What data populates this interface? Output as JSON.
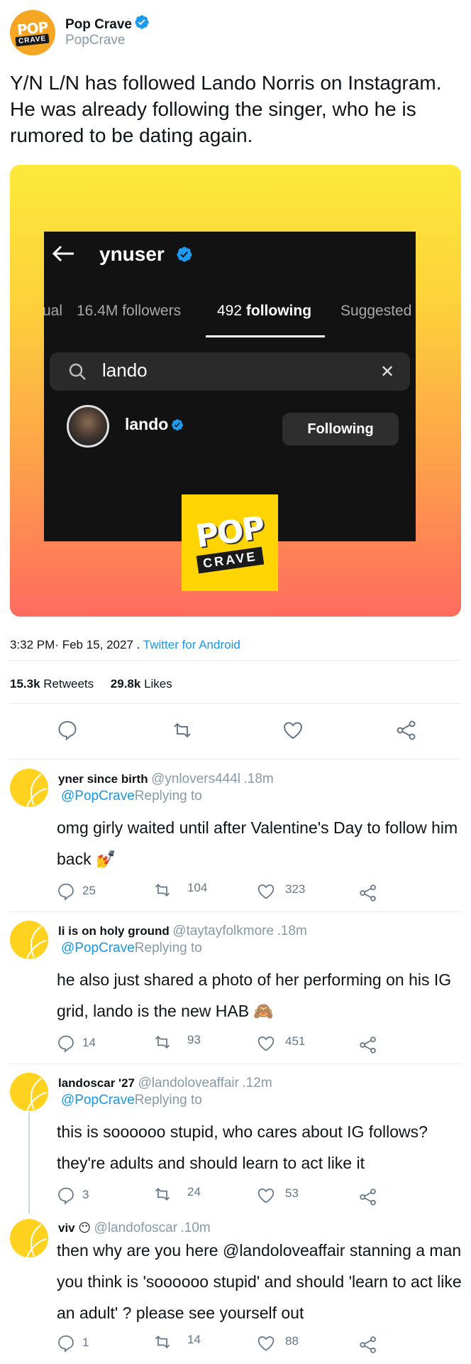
{
  "tweet": {
    "author_name": "Pop Crave",
    "author_handle": "PopCrave",
    "logo_pop": "POP",
    "logo_crave": "CRAVE",
    "text": "Y/N L/N has followed Lando Norris on Instagram. He was already following the singer, who he is rumored to be dating again.",
    "time": "3:32 PM",
    "date": "Feb 15, 2027",
    "separator": "·",
    "dot": " . ",
    "via": "Twitter for Android",
    "retweets_count": "15.3k",
    "retweets_label": "Retweets",
    "likes_count": "29.8k",
    "likes_label": "Likes"
  },
  "media": {
    "profile_user": "ynuser",
    "tab_partial": "ual",
    "followers_count": "16.4M",
    "followers_label": "followers",
    "following_count": "492",
    "following_label": "following",
    "suggested_label": "Suggested",
    "search_value": "lando",
    "clear_glyph": "✕",
    "result_name": "lando",
    "result_button": "Following",
    "watermark_pop": "POP",
    "watermark_crave": "CRAVE"
  },
  "actions": {
    "icons": [
      "reply-icon",
      "retweet-icon",
      "like-icon",
      "share-icon"
    ]
  },
  "replies": [
    {
      "name": "yner since birth",
      "handle": "@ynlovers444l",
      "time": ".18m",
      "replying_at": "@PopCrave",
      "replying_label": "Replying to",
      "text": "omg girly waited until after Valentine's Day to follow him back 💅",
      "reply_count": "25",
      "retweet_count": "104",
      "like_count": "323"
    },
    {
      "name": "li is on holy ground",
      "handle": "@taytayfolkmore",
      "time": ".18m",
      "replying_at": "@PopCrave",
      "replying_label": "Replying to",
      "text": "he also just shared a photo of her performing on his IG grid, lando is the new HAB 🙈",
      "reply_count": "14",
      "retweet_count": "93",
      "like_count": "451"
    },
    {
      "name": "landoscar '27",
      "handle": "@landoloveaffair",
      "time": ".12m",
      "replying_at": "@PopCrave",
      "replying_label": "Replying to",
      "text": "this is soooooo stupid, who cares about IG follows? they're adults and should learn to act like it",
      "reply_count": "3",
      "retweet_count": "24",
      "like_count": "53"
    },
    {
      "name": "viv 😶",
      "handle": "@landofoscar",
      "time": ".10m",
      "text": "then why are you here @landoloveaffair stanning a man you think is 'soooooo stupid' and should 'learn to act like an adult' ? please see yourself out",
      "reply_count": "1",
      "retweet_count": "14",
      "like_count": "88"
    }
  ],
  "colors": {
    "verified": "#1d9bf0",
    "link": "#1b95e0",
    "muted": "#8899a6",
    "reply_avatar": "#ffd21f"
  }
}
